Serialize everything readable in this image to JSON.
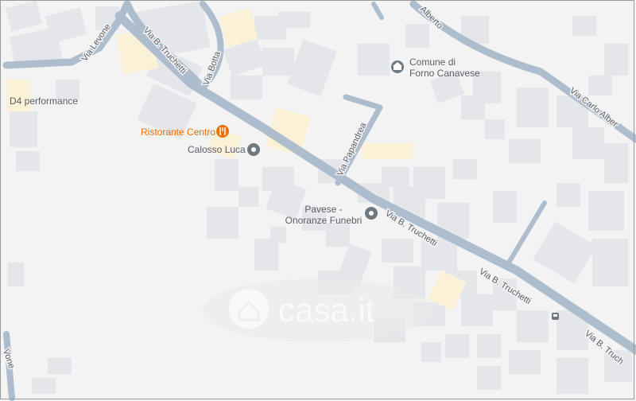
{
  "map": {
    "streets": [
      {
        "id": "via-levone",
        "label": "Via Levone"
      },
      {
        "id": "via-botta",
        "label": "Via Botta"
      },
      {
        "id": "via-b-truchetti-nw",
        "label": "Via B. Truchetti"
      },
      {
        "id": "via-b-truchetti-mid",
        "label": "Via B. Truchetti"
      },
      {
        "id": "via-b-truchetti-se",
        "label": "Via B. Truchetti"
      },
      {
        "id": "via-b-truchetti-far",
        "label": "Via B. Truch"
      },
      {
        "id": "via-papandrea",
        "label": "Via Papandrea"
      },
      {
        "id": "via-alberto",
        "label": "Alberto"
      },
      {
        "id": "via-carlo-alberto",
        "label": "Via Carlo Alber"
      },
      {
        "id": "via-edge-left",
        "label": "Vone"
      }
    ],
    "places": [
      {
        "id": "comune",
        "lines": [
          "Comune di",
          "Forno Canavese"
        ],
        "icon": "city-hall-icon"
      },
      {
        "id": "ristorante",
        "lines": [
          "Ristorante Centro"
        ],
        "icon": "restaurant-icon",
        "color": "#e8710a"
      },
      {
        "id": "calosso",
        "lines": [
          "Calosso Luca"
        ],
        "icon": "place-pin-icon"
      },
      {
        "id": "pavese",
        "lines": [
          "Pavese -",
          "Onoranze Funebri"
        ],
        "icon": "place-pin-icon"
      },
      {
        "id": "d4",
        "lines": [
          "D4 performance"
        ],
        "icon": null
      }
    ],
    "watermark": {
      "text": "casa.it",
      "icon": "house-icon"
    },
    "colors": {
      "land": "#f3f3f4",
      "block": "#e5e6ea",
      "road": "#adbdcd",
      "road_outline": "#9fb0c2",
      "highlight": "#fbf1d6",
      "label": "#5a5f66",
      "poi_gray": "#707880",
      "poi_orange": "#e8710a"
    }
  }
}
